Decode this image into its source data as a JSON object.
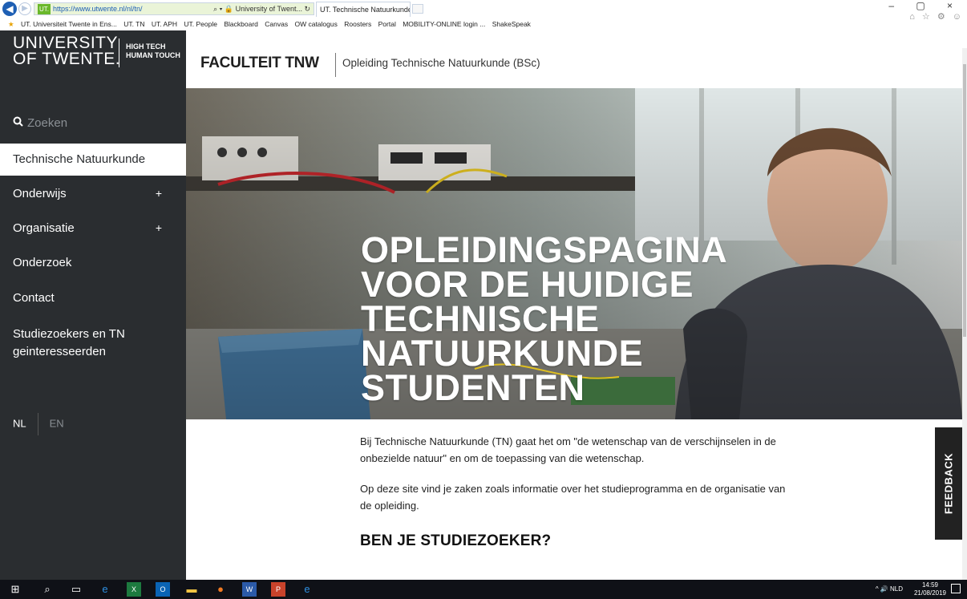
{
  "browser": {
    "back_icon": "back-arrow-icon",
    "address_badge": "UT.",
    "url": "https://www.utwente.nl/nl/tn/",
    "address_right": "⌕ ▾ 🔒 University of Twent... ↻",
    "tab_title": "UT. Technische Natuurkunde | ...",
    "tab_close": "×",
    "window_controls": "– ▢ ×",
    "window_icons": "⌂ ☆ ⚙ ☺"
  },
  "favorites": [
    "UT. Universiteit Twente in Ens...",
    "UT. TN",
    "UT. APH",
    "UT. People",
    "Blackboard",
    "Canvas",
    "OW catalogus",
    "Roosters",
    "Portal",
    "MOBILITY-ONLINE login ...",
    "ShakeSpeak"
  ],
  "sidebar": {
    "logo_main": "UNIVERSITY OF TWENTE.",
    "logo_line1": "UNIVERSITY",
    "logo_line2": "OF TWENTE.",
    "logo_tag_line1": "HIGH TECH",
    "logo_tag_line2": "HUMAN TOUCH",
    "search_label": "Zoeken",
    "active_item": "Technische Natuurkunde",
    "items": [
      {
        "label": "Onderwijs",
        "expand": "+"
      },
      {
        "label": "Organisatie",
        "expand": "+"
      },
      {
        "label": "Onderzoek"
      },
      {
        "label": "Contact"
      },
      {
        "label": "Studiezoekers en TN geinteresseerden"
      }
    ],
    "lang_nl": "NL",
    "lang_en": "EN"
  },
  "header": {
    "faculty": "FACULTEIT TNW",
    "program": "Opleiding Technische Natuurkunde (BSc)"
  },
  "hero": {
    "title": "OPLEIDINGSPAGINA VOOR DE HUIDIGE TECHNISCHE NATUURKUNDE STUDENTEN"
  },
  "content": {
    "paragraph1": "Bij Technische Natuurkunde (TN) gaat het om \"de wetenschap van de verschijnselen in de onbezielde natuur\" en om de toepassing van die wetenschap.",
    "paragraph2": "Op deze site vind je zaken zoals informatie over het studieprogramma en de organisatie van de opleiding.",
    "heading": "BEN JE STUDIEZOEKER?"
  },
  "feedback_label": "FEEDBACK",
  "taskbar": {
    "tray": "^ 🔊 NLD",
    "time": "14:59",
    "date": "21/08/2019"
  }
}
